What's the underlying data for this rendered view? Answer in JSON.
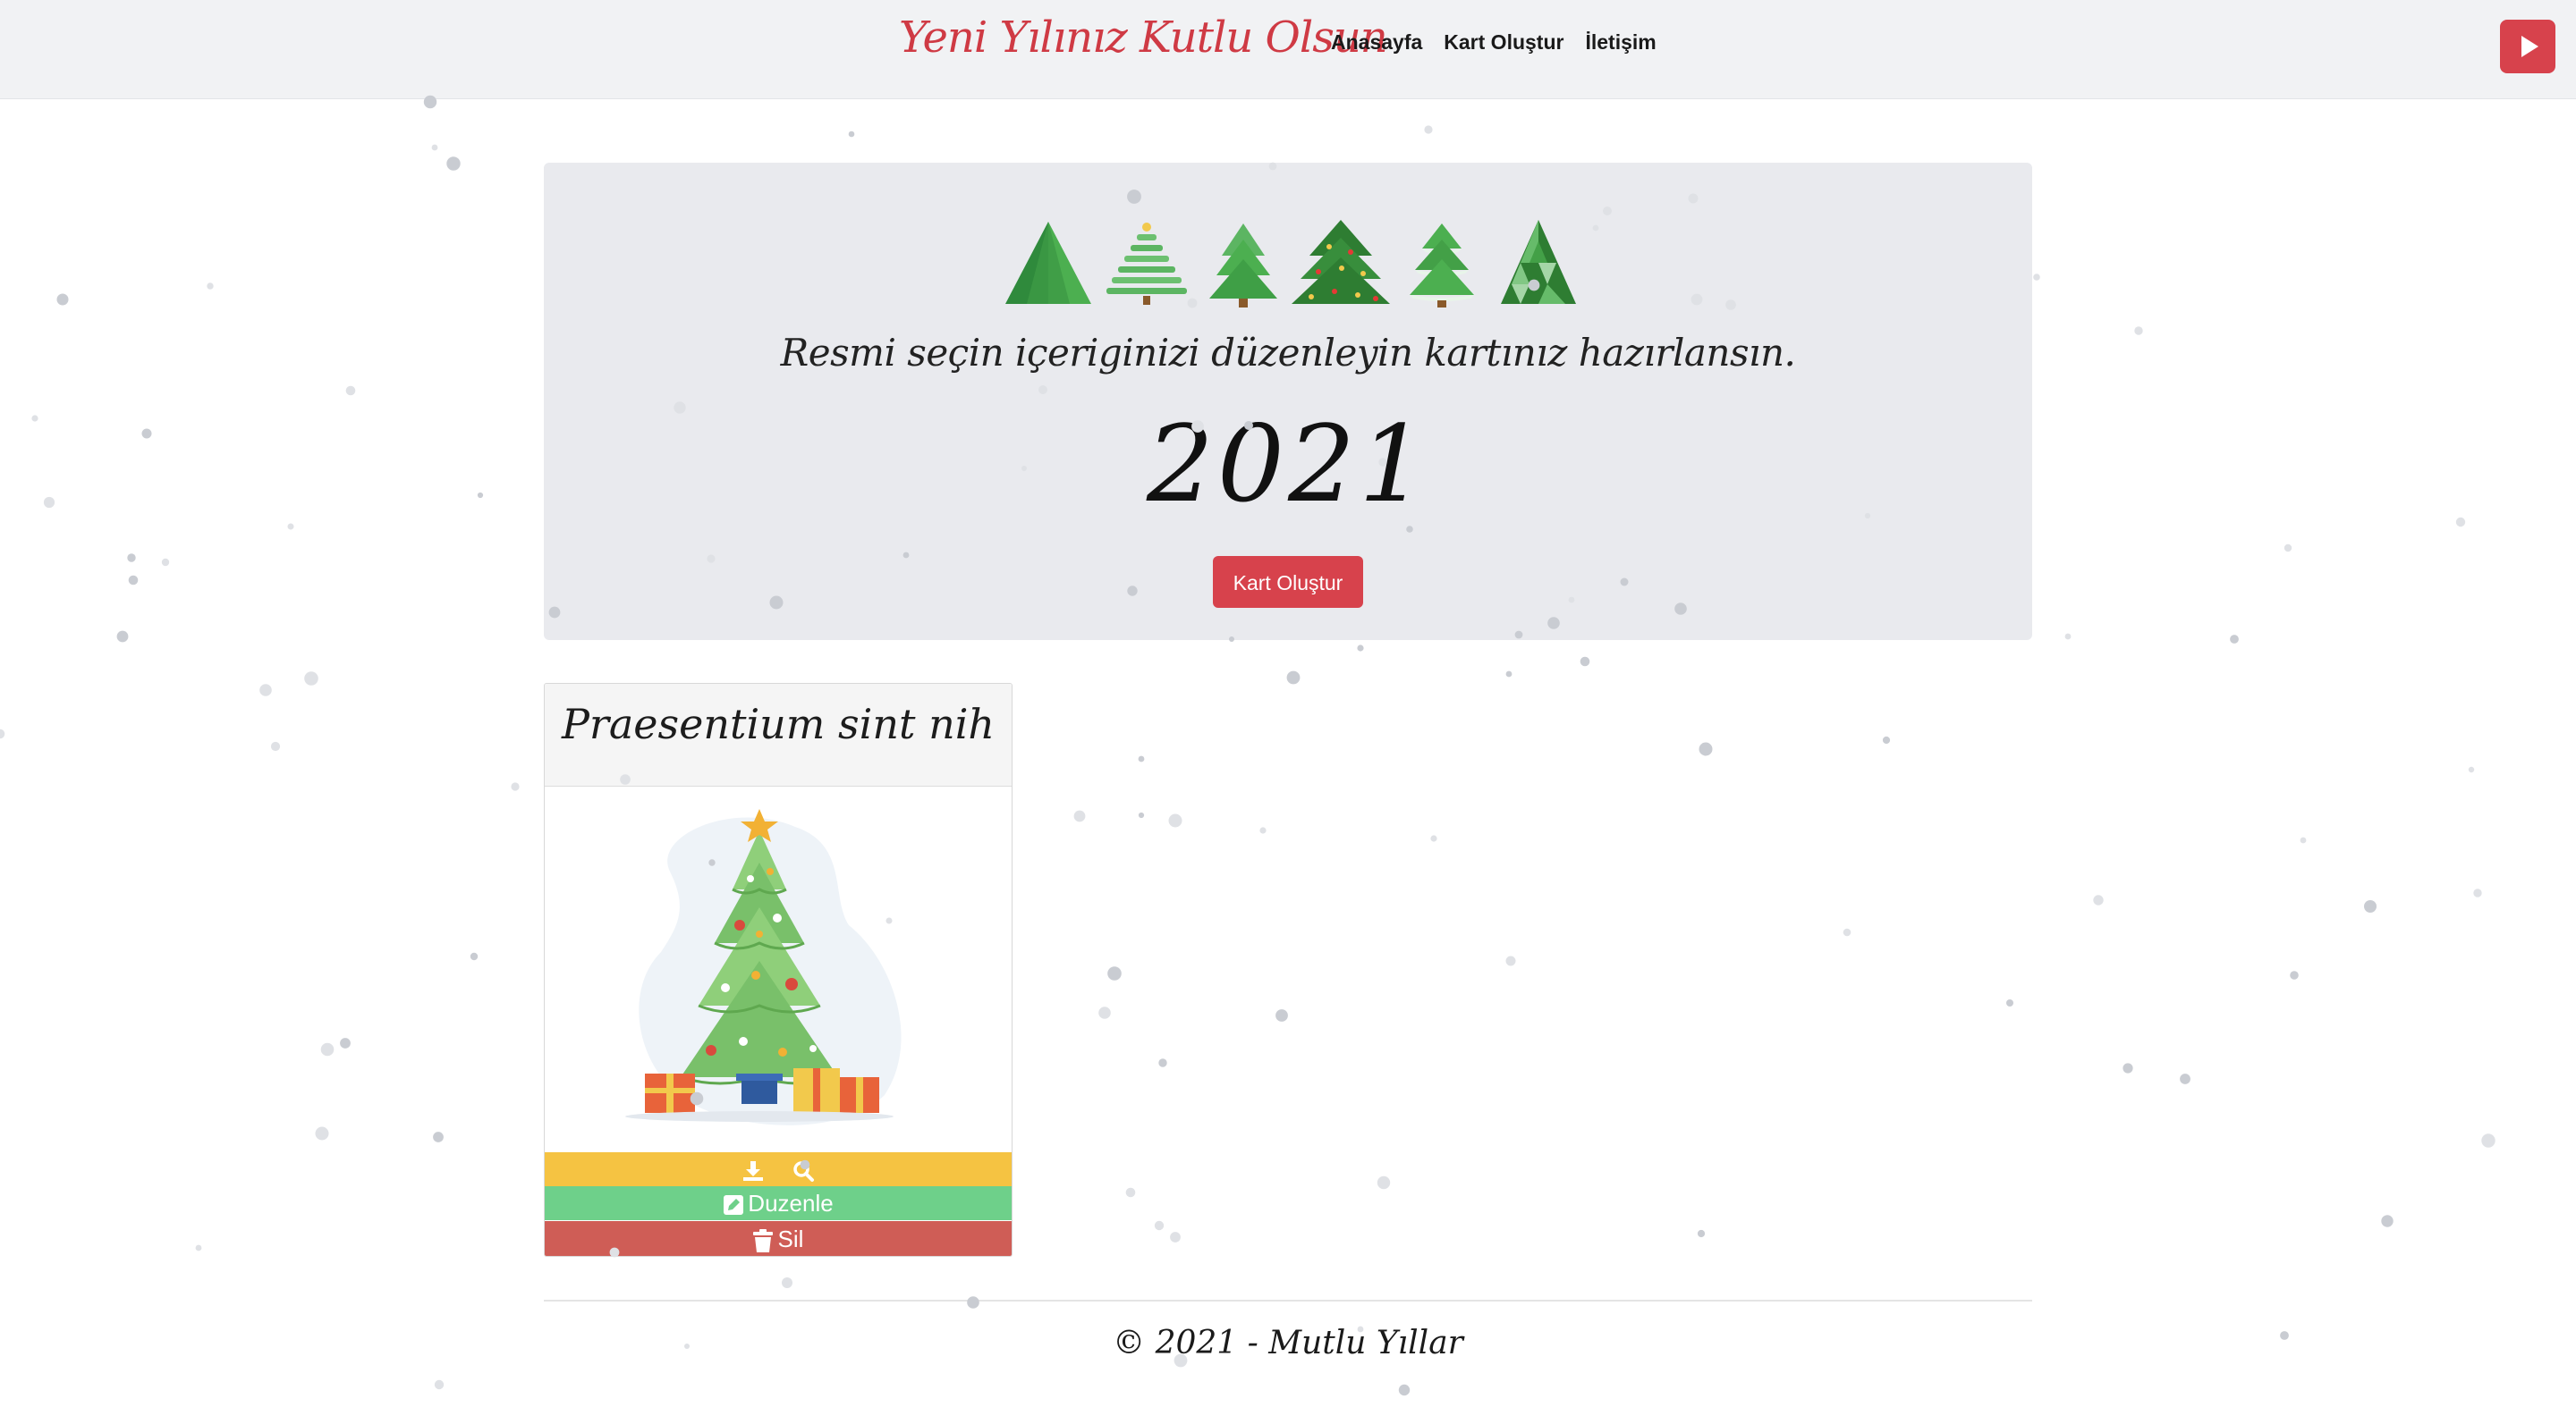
{
  "navbar": {
    "brand": "Yeni Yılınız Kutlu Olsun",
    "links": [
      "Anasayfa",
      "Kart Oluştur",
      "İletişim"
    ],
    "play_icon": "play-icon",
    "accent": "#d7424c"
  },
  "hero": {
    "tree_icons": [
      "paper-tree-icon",
      "stacked-tree-icon",
      "pine-tree-icon",
      "decorated-tree-icon",
      "snowy-tree-icon",
      "geometric-tree-icon"
    ],
    "tagline": "Resmi seçin içeriginizi düzenleyin kartınız hazırlansın.",
    "year": "2021",
    "button_label": "Kart Oluştur"
  },
  "cards": [
    {
      "title": "Praesentium sint nih",
      "image_icon": "christmas-tree-illustration",
      "actions": {
        "download_icon": "download-icon",
        "view_icon": "search-icon",
        "edit_label": "Duzenle",
        "edit_icon": "edit-icon",
        "delete_label": "Sil",
        "delete_icon": "trash-icon"
      }
    }
  ],
  "footer": {
    "text": "© 2021 - Mutlu Yıllar"
  },
  "colors": {
    "action_yellow": "#f5c342",
    "action_green": "#6ed08a",
    "action_red": "#cf5d56"
  }
}
